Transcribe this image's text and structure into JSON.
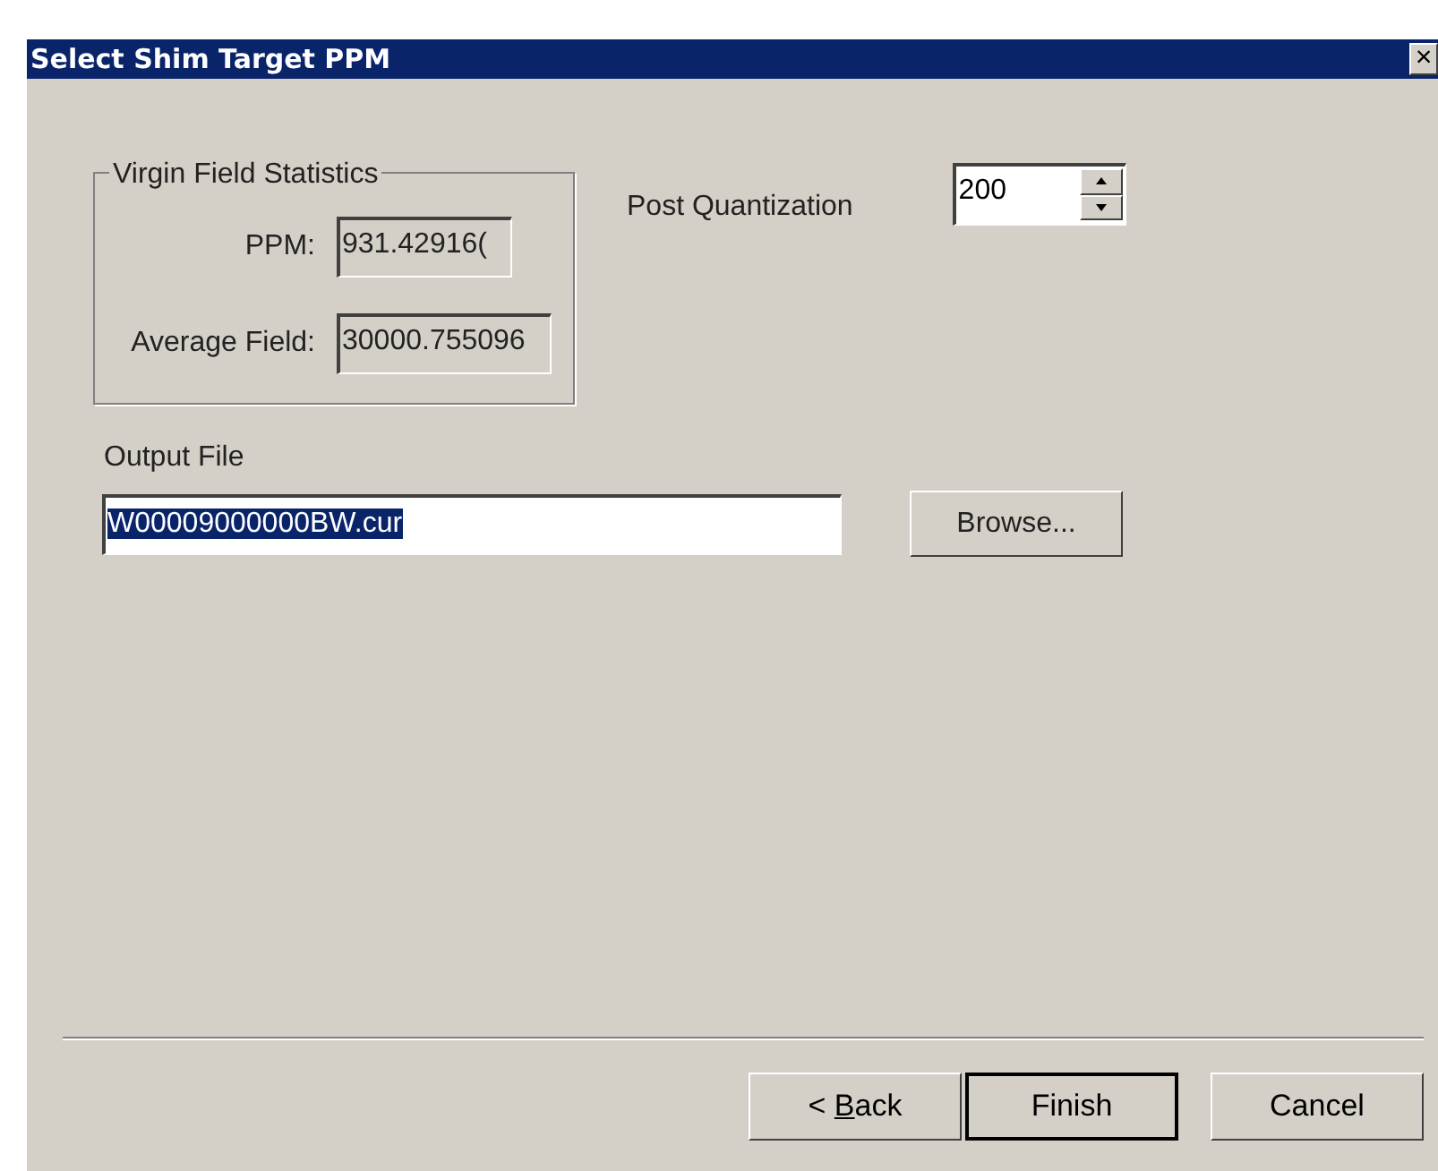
{
  "window": {
    "title": "Select Shim Target PPM",
    "close": "×"
  },
  "group": {
    "legend": "Virgin Field Statistics",
    "fields": [
      {
        "label": "PPM:",
        "value": "931.42916("
      },
      {
        "label": "Average Field:",
        "value": "30000.755096"
      }
    ]
  },
  "post_quantization": {
    "label": "Post Quantization",
    "value": "200"
  },
  "output_file": {
    "label": "Output File",
    "value": "W00009000000BW.cur",
    "selected": true,
    "browse": "Browse..."
  },
  "buttons": [
    {
      "label_start": "< ",
      "mnemonic": "B",
      "label_end": "ack",
      "default": false
    },
    {
      "label": "Finish",
      "default": true
    },
    {
      "label": "Cancel",
      "default": false
    }
  ]
}
